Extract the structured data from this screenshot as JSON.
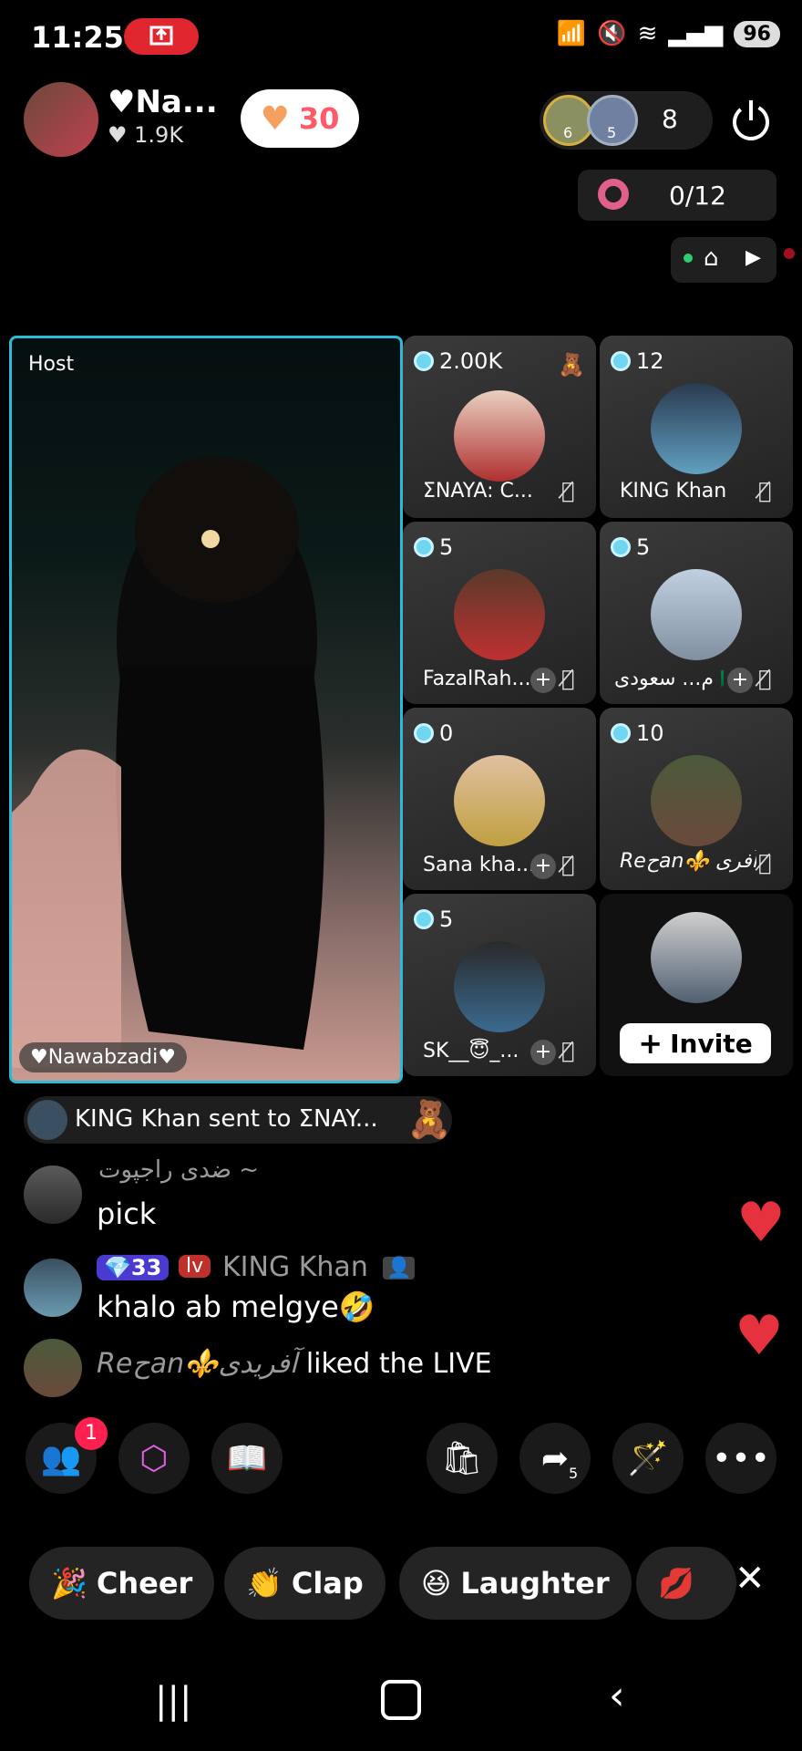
{
  "status_bar": {
    "time": "11:25",
    "battery": "96"
  },
  "host": {
    "name": "♥Na...",
    "likes": "1.9K",
    "follow_count": "30"
  },
  "viewers": {
    "badge1": "6",
    "badge2": "5",
    "count": "8"
  },
  "goal": {
    "progress": "0/12"
  },
  "host_tile": {
    "label": "Host",
    "nameplate": "♥Nawabzadi♥"
  },
  "guests": [
    {
      "coins": "2.00K",
      "name": "ΣNAYA: C...",
      "color": "#b03030"
    },
    {
      "coins": "12",
      "name": "KING Khan",
      "color": "#3a5060"
    },
    {
      "coins": "5",
      "name": "FazalRah...",
      "color": "#7a3030"
    },
    {
      "coins": "5",
      "name": "م... سعودی 🇸🇦",
      "color": "#8090a0"
    },
    {
      "coins": "0",
      "name": "Sana kha...",
      "color": "#c0a060"
    },
    {
      "coins": "10",
      "name": "Reحan⚜️ آفری...",
      "color": "#4a4030"
    },
    {
      "coins": "5",
      "name": "SK__😇_...",
      "color": "#2a4a60"
    }
  ],
  "invite": {
    "label": "Invite"
  },
  "gift_notice": {
    "text": "KING Khan sent to ΣNAY..."
  },
  "chat": [
    {
      "name": "ضدی راجپوت ~",
      "message": "pick"
    },
    {
      "badge1": "33",
      "badge2": "lv",
      "name": "KING Khan",
      "message": "khalo ab melgye🤣"
    },
    {
      "name": "Reحan⚜️آفریدی",
      "message": "liked the LIVE"
    }
  ],
  "toolbar": {
    "notification_count": "1",
    "share_count": "5"
  },
  "reactions": [
    {
      "label": "Cheer"
    },
    {
      "label": "Clap"
    },
    {
      "label": "Laughter"
    }
  ]
}
